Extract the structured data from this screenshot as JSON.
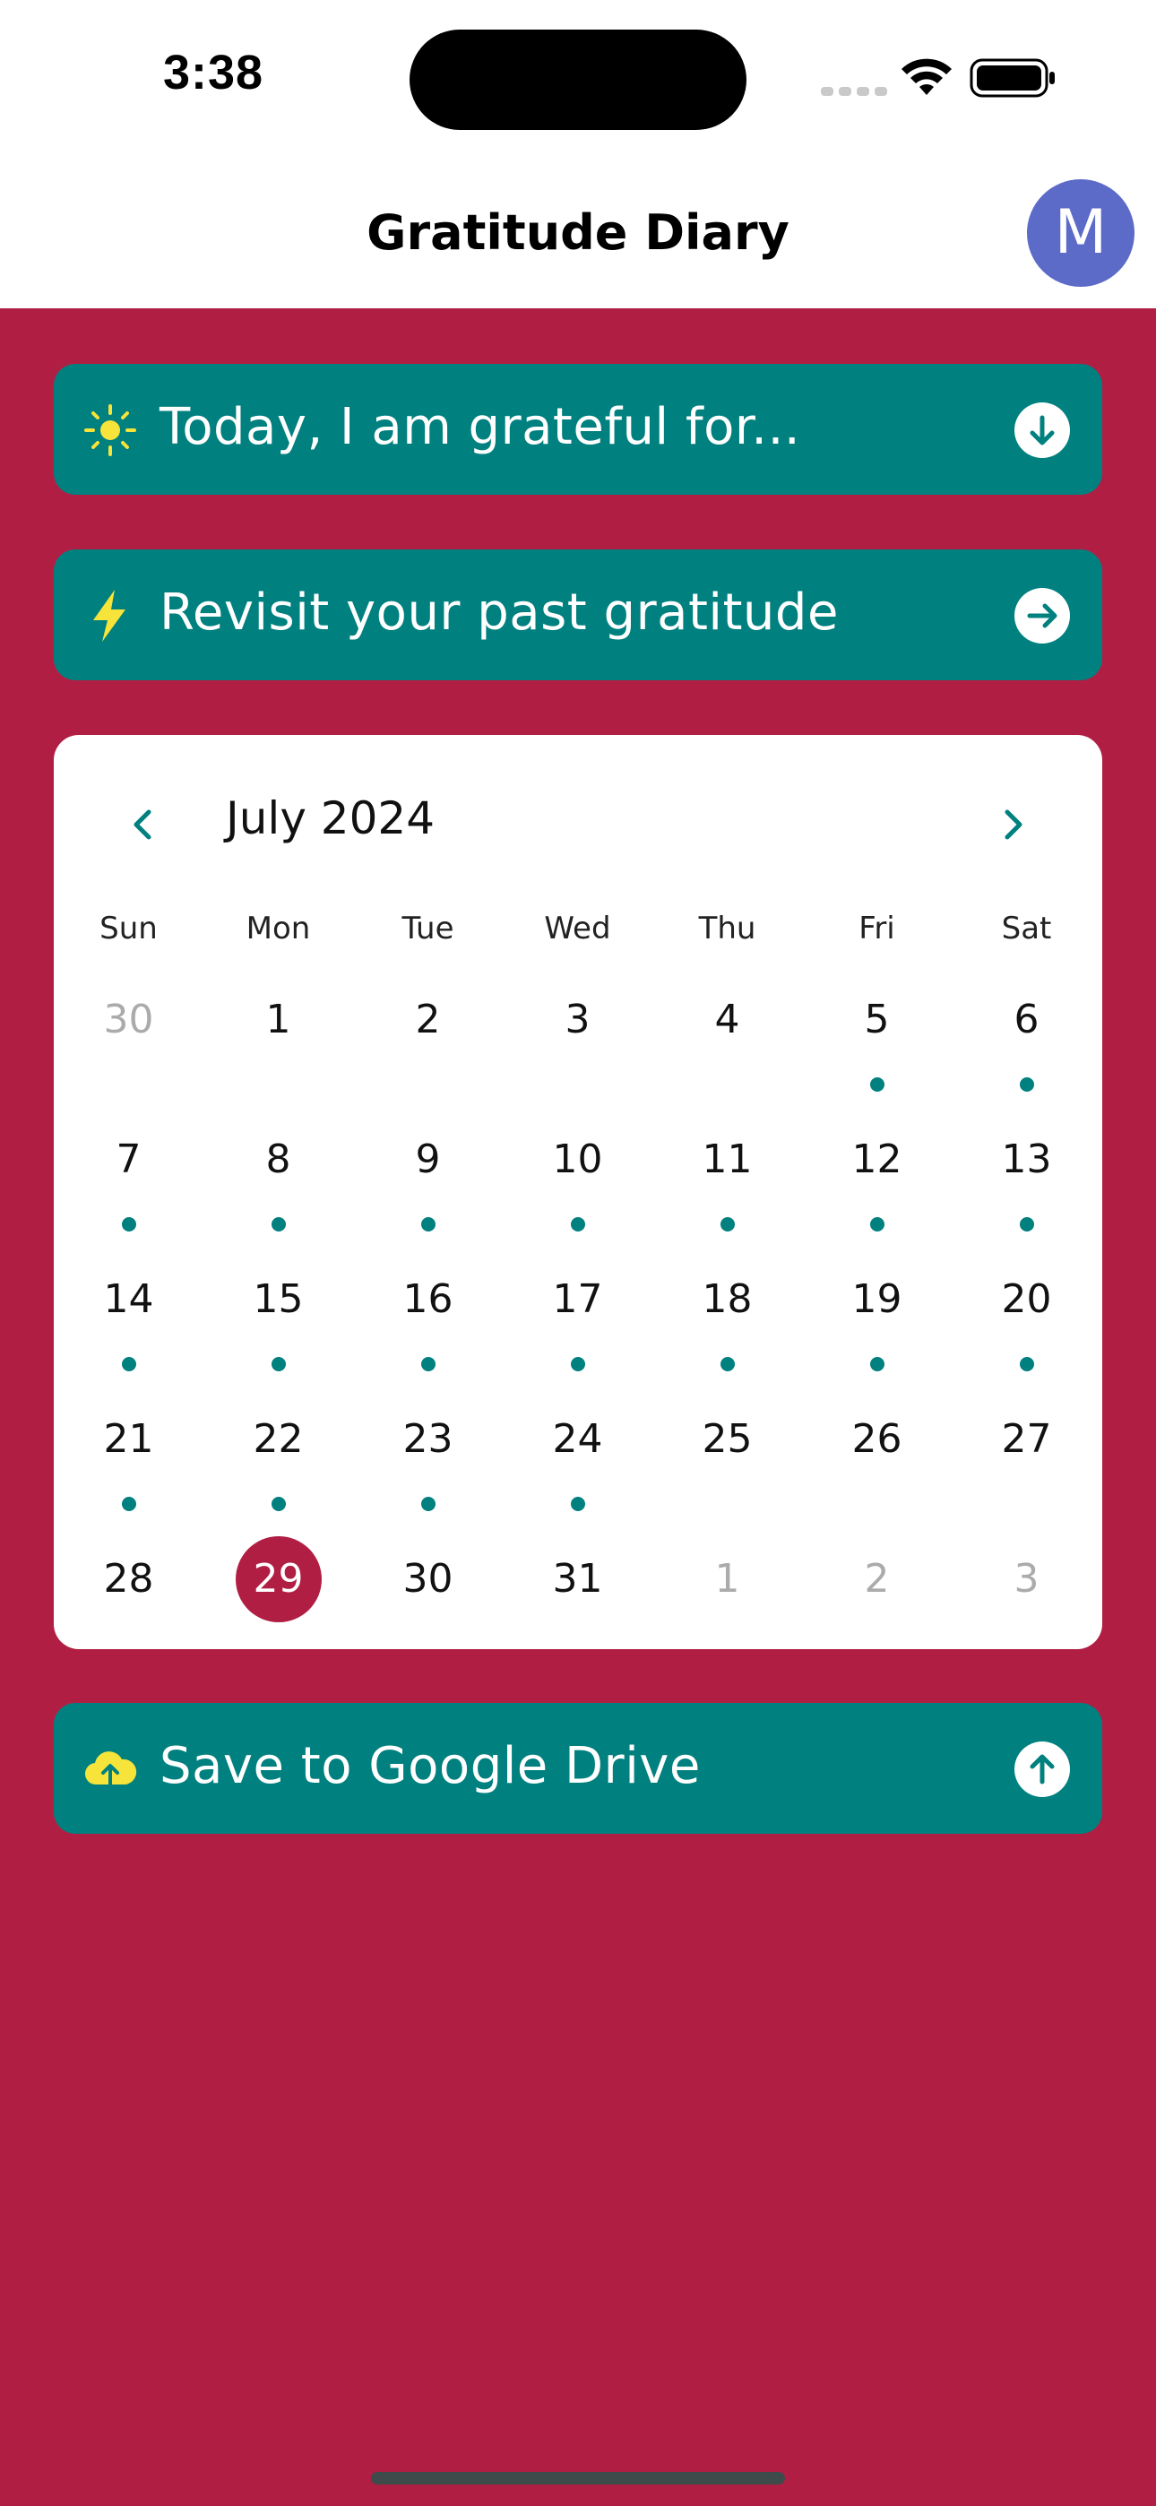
{
  "status_bar": {
    "time": "3:38"
  },
  "header": {
    "title": "Gratitude Diary",
    "avatar_initial": "M"
  },
  "actions": {
    "today": {
      "label": "Today, I am grateful for...",
      "icon": "sun-icon",
      "trail_icon": "arrow-down-circle-icon"
    },
    "revisit": {
      "label": "Revisit your past gratitude",
      "icon": "lightning-icon",
      "trail_icon": "arrow-right-circle-icon"
    },
    "save": {
      "label": "Save to Google Drive",
      "icon": "cloud-upload-icon",
      "trail_icon": "arrow-up-circle-icon"
    }
  },
  "calendar": {
    "month_label": "July 2024",
    "weekdays": [
      "Sun",
      "Mon",
      "Tue",
      "Wed",
      "Thu",
      "Fri",
      "Sat"
    ],
    "selected_day": "29",
    "weeks": [
      [
        {
          "d": "30",
          "muted": true,
          "dot": false
        },
        {
          "d": "1",
          "muted": false,
          "dot": false
        },
        {
          "d": "2",
          "muted": false,
          "dot": false
        },
        {
          "d": "3",
          "muted": false,
          "dot": false
        },
        {
          "d": "4",
          "muted": false,
          "dot": false
        },
        {
          "d": "5",
          "muted": false,
          "dot": true
        },
        {
          "d": "6",
          "muted": false,
          "dot": true
        }
      ],
      [
        {
          "d": "7",
          "muted": false,
          "dot": true
        },
        {
          "d": "8",
          "muted": false,
          "dot": true
        },
        {
          "d": "9",
          "muted": false,
          "dot": true
        },
        {
          "d": "10",
          "muted": false,
          "dot": true
        },
        {
          "d": "11",
          "muted": false,
          "dot": true
        },
        {
          "d": "12",
          "muted": false,
          "dot": true
        },
        {
          "d": "13",
          "muted": false,
          "dot": true
        }
      ],
      [
        {
          "d": "14",
          "muted": false,
          "dot": true
        },
        {
          "d": "15",
          "muted": false,
          "dot": true
        },
        {
          "d": "16",
          "muted": false,
          "dot": true
        },
        {
          "d": "17",
          "muted": false,
          "dot": true
        },
        {
          "d": "18",
          "muted": false,
          "dot": true
        },
        {
          "d": "19",
          "muted": false,
          "dot": true
        },
        {
          "d": "20",
          "muted": false,
          "dot": true
        }
      ],
      [
        {
          "d": "21",
          "muted": false,
          "dot": true
        },
        {
          "d": "22",
          "muted": false,
          "dot": true
        },
        {
          "d": "23",
          "muted": false,
          "dot": true
        },
        {
          "d": "24",
          "muted": false,
          "dot": true
        },
        {
          "d": "25",
          "muted": false,
          "dot": false
        },
        {
          "d": "26",
          "muted": false,
          "dot": false
        },
        {
          "d": "27",
          "muted": false,
          "dot": false
        }
      ],
      [
        {
          "d": "28",
          "muted": false,
          "dot": false
        },
        {
          "d": "29",
          "muted": false,
          "dot": false,
          "selected": true
        },
        {
          "d": "30",
          "muted": false,
          "dot": false
        },
        {
          "d": "31",
          "muted": false,
          "dot": false
        },
        {
          "d": "1",
          "muted": true,
          "dot": false
        },
        {
          "d": "2",
          "muted": true,
          "dot": false
        },
        {
          "d": "3",
          "muted": true,
          "dot": false
        }
      ]
    ]
  },
  "colors": {
    "background": "#B01F43",
    "card": "#00807F",
    "accent_icon": "#F6E43A",
    "avatar": "#5D6BC8",
    "selected_day": "#B01F43"
  }
}
